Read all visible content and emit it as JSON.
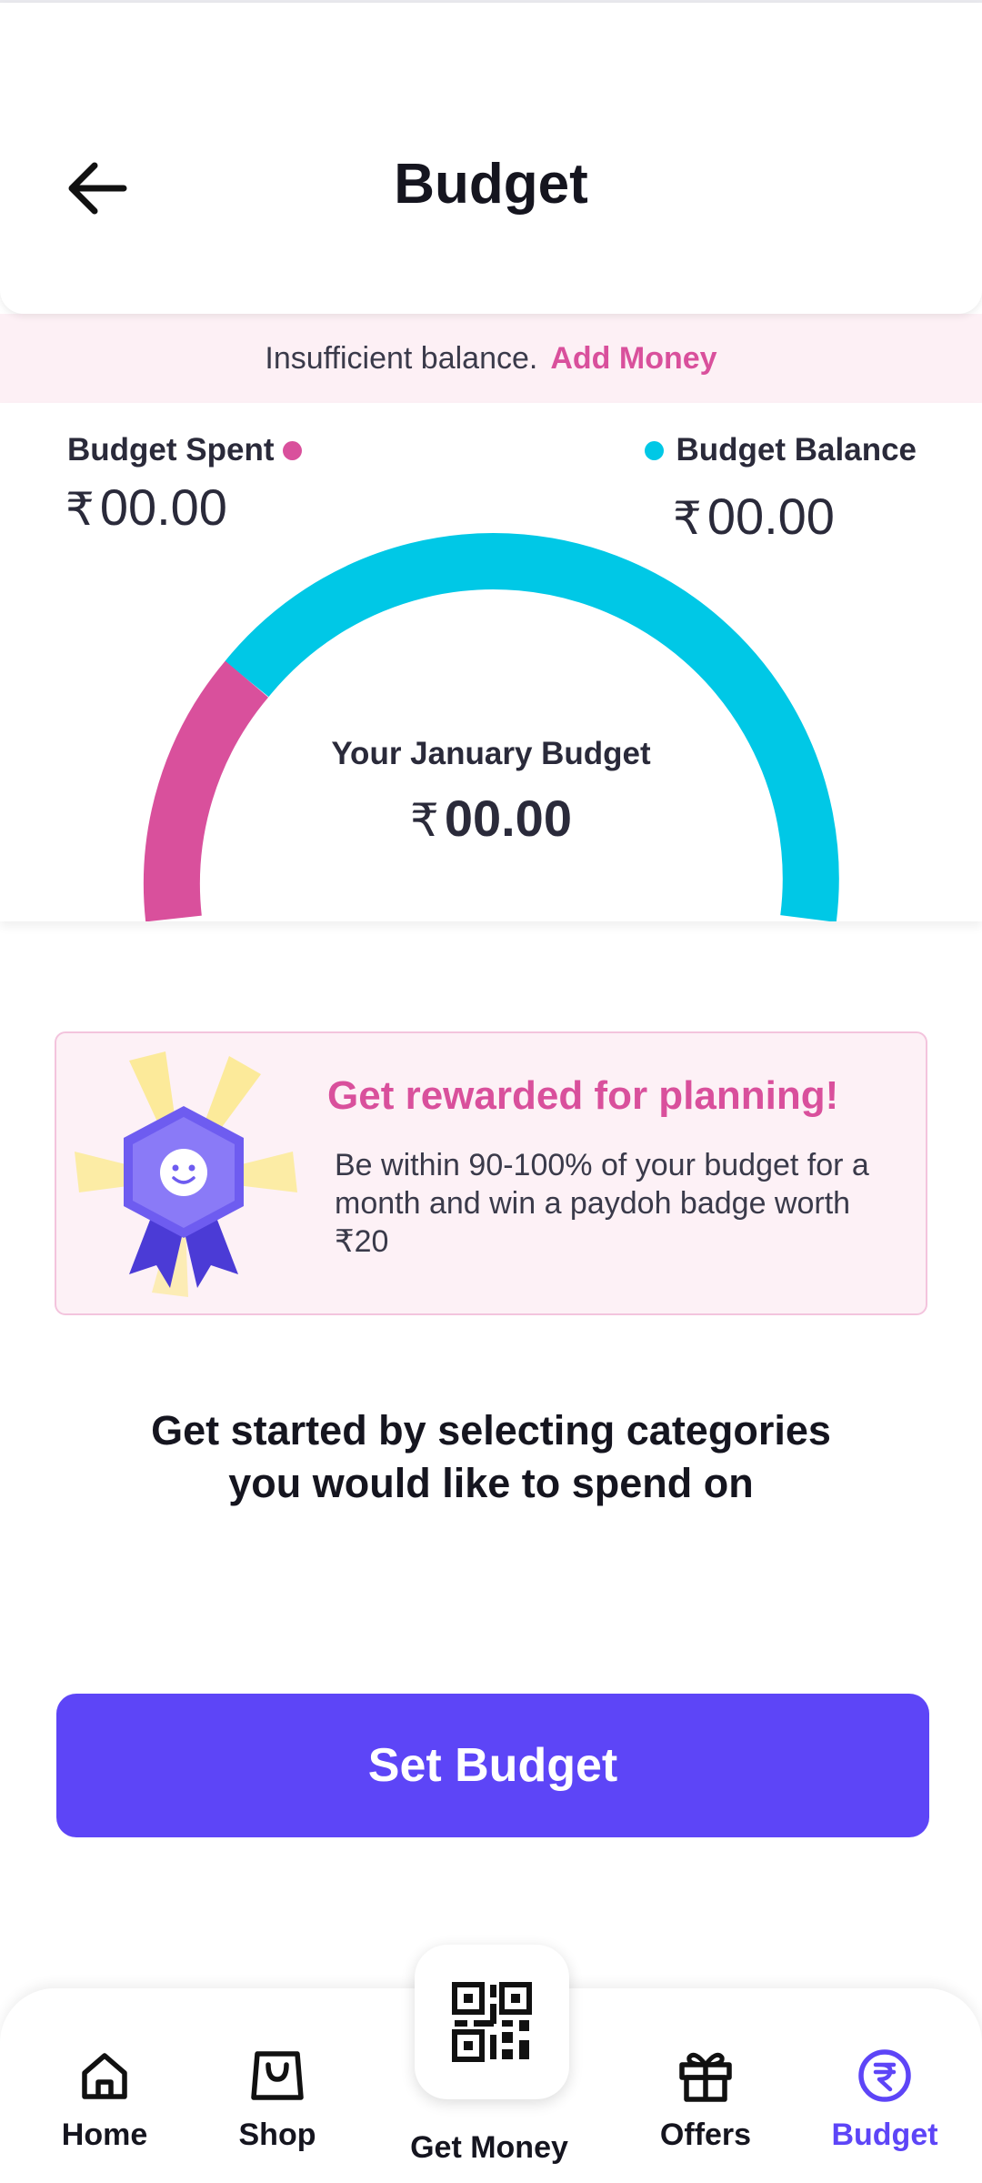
{
  "header": {
    "title": "Budget"
  },
  "alert": {
    "message": "Insufficient balance.",
    "action": "Add Money"
  },
  "summary": {
    "spent_label": "Budget Spent",
    "spent_amount": "00.00",
    "balance_label": "Budget Balance",
    "balance_amount": "00.00",
    "currency": "₹",
    "month_label": "Your January Budget",
    "month_amount": "00.00",
    "colors": {
      "spent": "#d9509c",
      "balance": "#00c8e6"
    }
  },
  "reward": {
    "title": "Get rewarded for planning!",
    "text": "Be within 90-100% of your budget for a month and win a paydoh badge worth ₹20"
  },
  "cta": {
    "text": "Get started by selecting categories you would like to spend on"
  },
  "primary_button": {
    "label": "Set Budget",
    "color": "#5d45f7"
  },
  "bottom_nav": {
    "items": [
      {
        "label": "Home",
        "icon": "home-icon"
      },
      {
        "label": "Shop",
        "icon": "shopping-bag-icon"
      },
      {
        "label": "Get Money",
        "icon": "qr-code-icon"
      },
      {
        "label": "Offers",
        "icon": "gift-icon"
      },
      {
        "label": "Budget",
        "icon": "rupee-circle-icon",
        "active": true
      }
    ]
  }
}
